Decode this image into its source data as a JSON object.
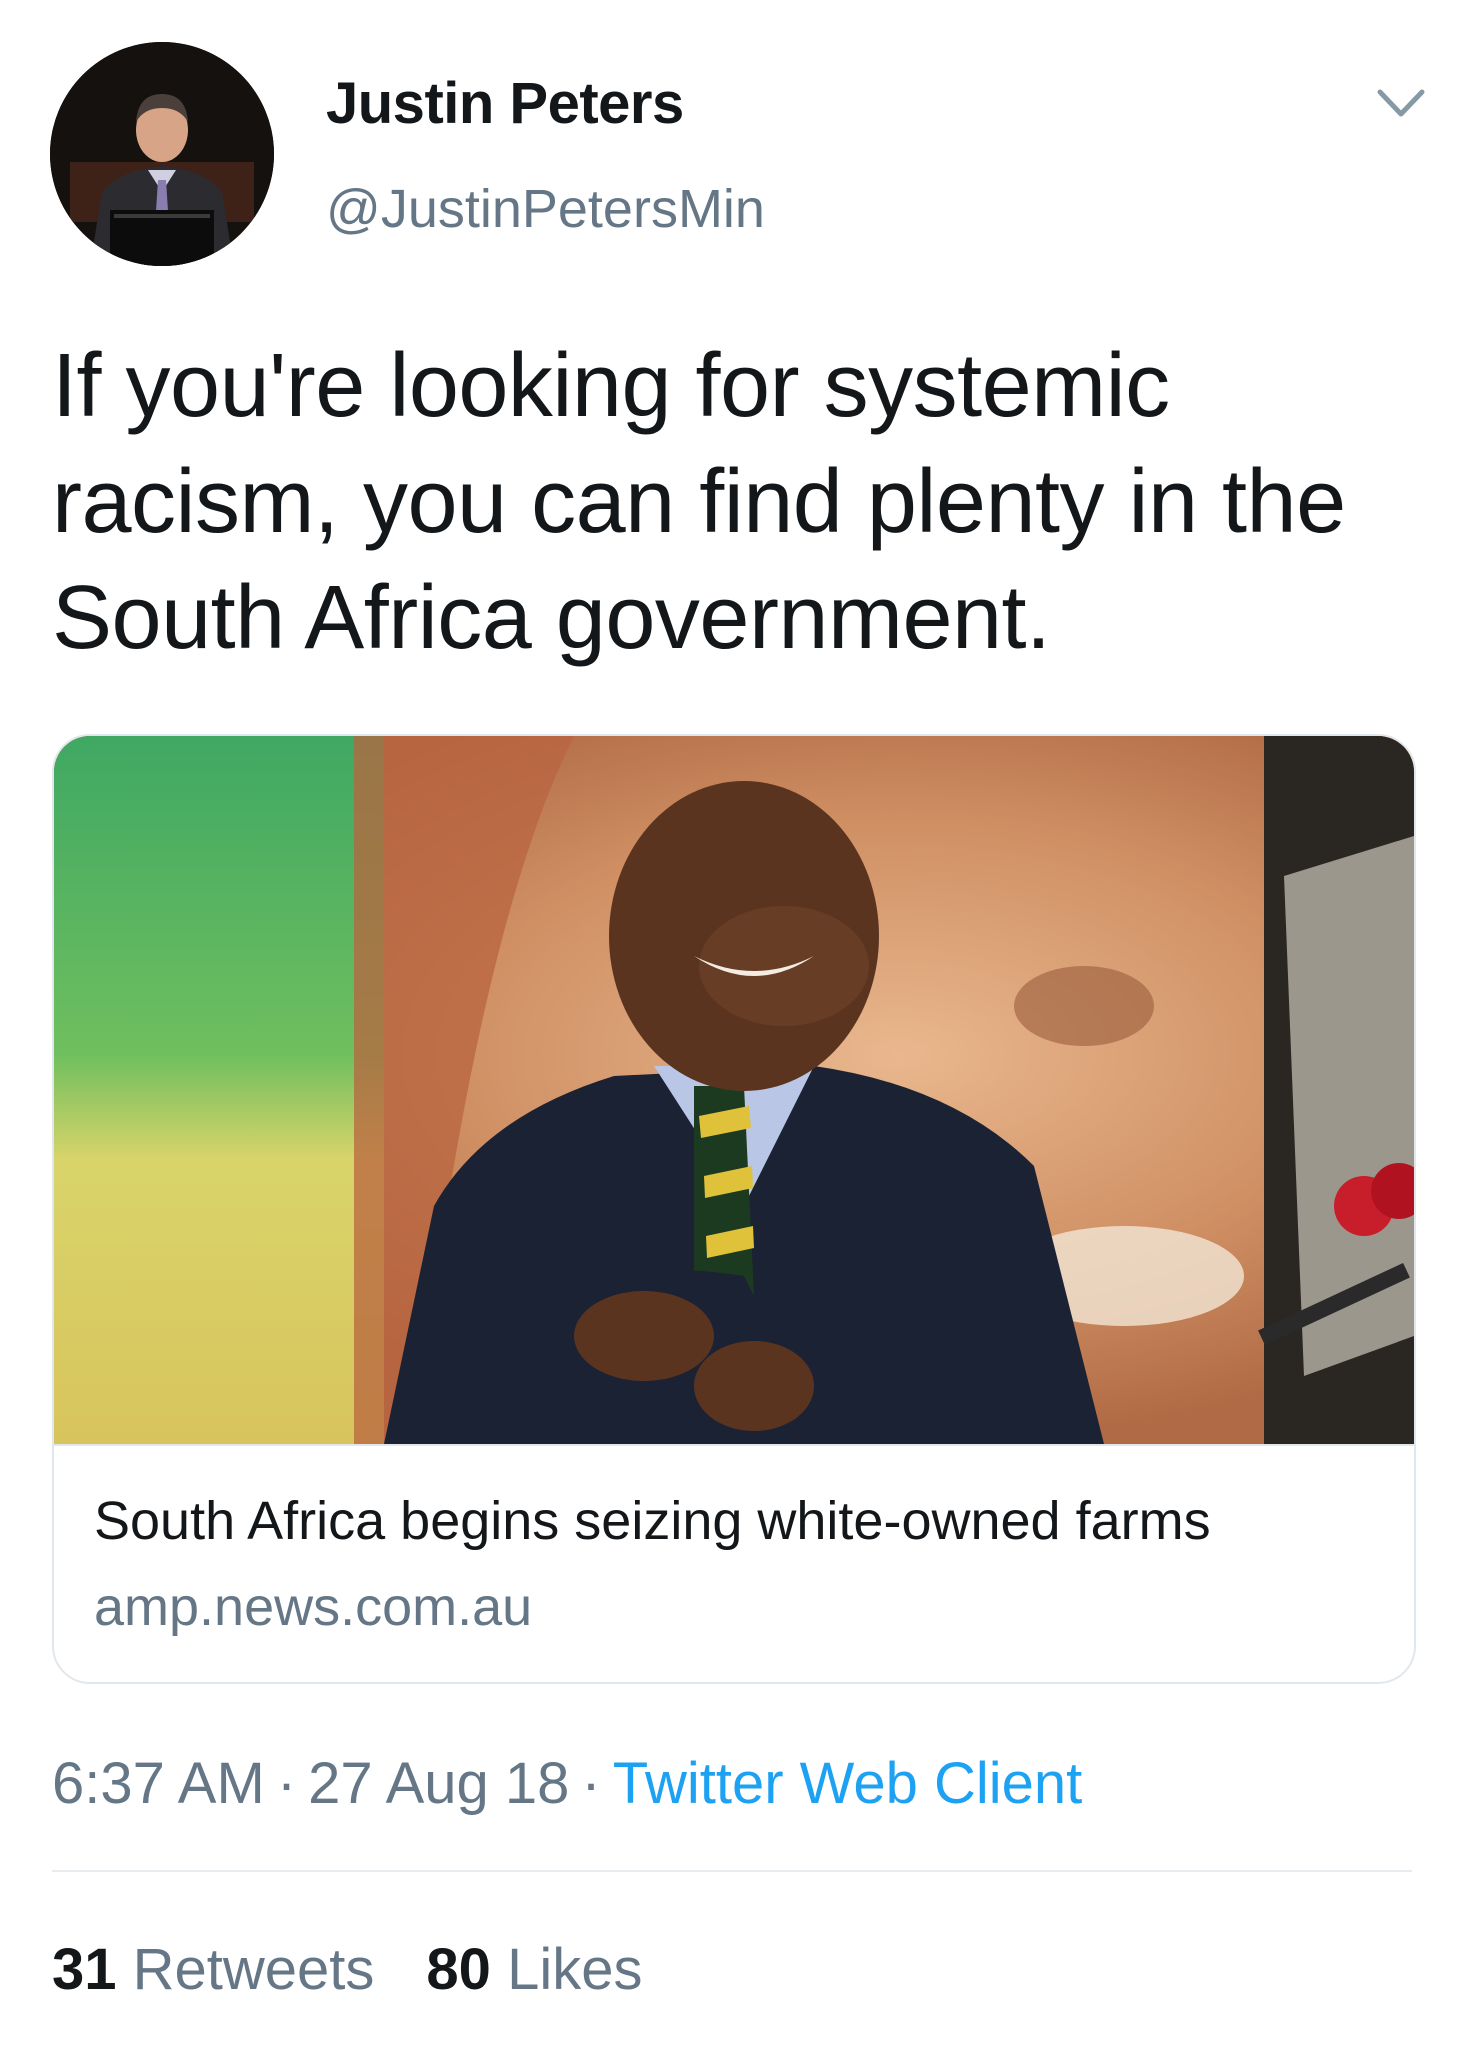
{
  "tweet": {
    "author": {
      "display_name": "Justin Peters",
      "handle": "@JustinPetersMin",
      "avatar_icon": "profile-photo"
    },
    "menu_icon": "chevron-down-icon",
    "text": "If you're looking for systemic racism, you can find plenty in the South Africa government.",
    "card": {
      "title": "South Africa begins seizing white-owned farms",
      "domain": "amp.news.com.au",
      "image_icon": "news-photo"
    },
    "meta": {
      "time": "6:37 AM",
      "separator": "·",
      "date": "27 Aug 18",
      "client": "Twitter Web Client"
    },
    "stats": {
      "retweets_count": "31",
      "retweets_label": "Retweets",
      "likes_count": "80",
      "likes_label": "Likes"
    }
  },
  "colors": {
    "primary_text": "#14171a",
    "secondary_text": "#657786",
    "link": "#1da1f2",
    "border": "#e1e8ed"
  }
}
